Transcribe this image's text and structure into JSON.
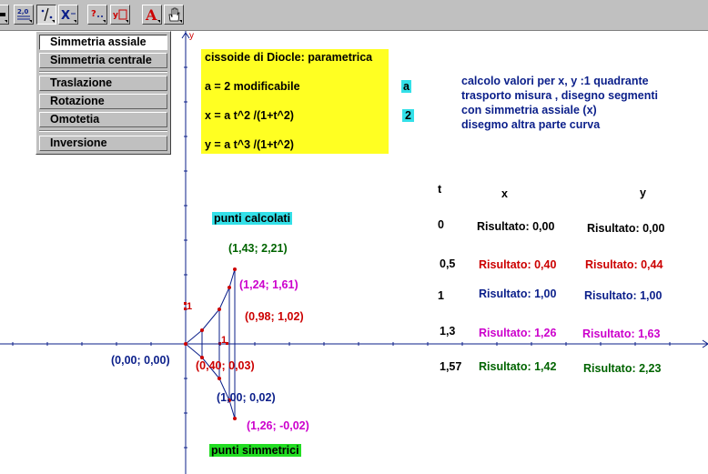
{
  "toolbar": {
    "items": [
      {
        "name": "segment-tool-icon",
        "glyph": "▬"
      },
      {
        "name": "point-coords-tool-icon",
        "glyph": "∷"
      },
      {
        "name": "measure-tool-icon",
        "glyph": "≠"
      },
      {
        "name": "symmetry-tool-icon",
        "glyph": "╱"
      },
      {
        "name": "transform-tool-icon",
        "glyph": "X"
      },
      {
        "name": "macro-tool-icon",
        "glyph": "?"
      },
      {
        "name": "calculator-tool-icon",
        "glyph": "y"
      },
      {
        "name": "text-tool-icon",
        "glyph": "A"
      },
      {
        "name": "hand-tool-icon",
        "glyph": "✋"
      }
    ]
  },
  "menu": {
    "items": [
      "Simmetria assiale",
      "Simmetria centrale",
      "Traslazione",
      "Rotazione",
      "Omotetia",
      "Inversione"
    ]
  },
  "axes": {
    "y_label": "y",
    "y_tick": "1",
    "x_tick": "1"
  },
  "info_box": {
    "line1": "cissoide di Diocle: parametrica",
    "line2": "a = 2 modificabile",
    "line3": "x = a t^2 /(1+t^2)",
    "line4": "y =  a t^3 /(1+t^2)"
  },
  "param": {
    "a_label": "a",
    "a_value": "2"
  },
  "notes": {
    "line1": "calcolo valori per x, y :1 quadrante",
    "line2": "trasporto misura , disegno segmenti",
    "line3": "con simmetria assiale (x)",
    "line4": "disegmo altra parte curva"
  },
  "labels": {
    "computed": "punti calcolati",
    "symmetric": "punti simmetrici"
  },
  "table": {
    "headers": {
      "t": "t",
      "x": "x",
      "y": "y"
    },
    "rows": [
      {
        "t": "0",
        "x": "Risultato: 0,00",
        "y": "Risultato: 0,00"
      },
      {
        "t": "0,5",
        "x": "Risultato: 0,40",
        "y": "Risultato: 0,44"
      },
      {
        "t": "1",
        "x": "Risultato: 1,00",
        "y": "Risultato: 1,00"
      },
      {
        "t": "1,3",
        "x": "Risultato: 1,26",
        "y": "Risultato: 1,63"
      },
      {
        "t": "1,57",
        "x": "Risultato: 1,42",
        "y": "Risultato: 2,23"
      }
    ]
  },
  "points": {
    "p_origin": "(0,00; 0,00)",
    "p1": "(1,43; 2,21)",
    "p2": "(1,24; 1,61)",
    "p3": "(0,98; 1,02)",
    "p4": "(0,40; 0,03)",
    "p5": "(1,00; 0,02)",
    "p6": "(1,26; -0,02)"
  },
  "colors": {
    "navy": "#0b1f8a",
    "red": "#cc0000",
    "magenta": "#cc00cc",
    "green": "#006400",
    "yellow": "#ffff22",
    "cyan": "#33e0e8",
    "lime": "#22dd22"
  }
}
